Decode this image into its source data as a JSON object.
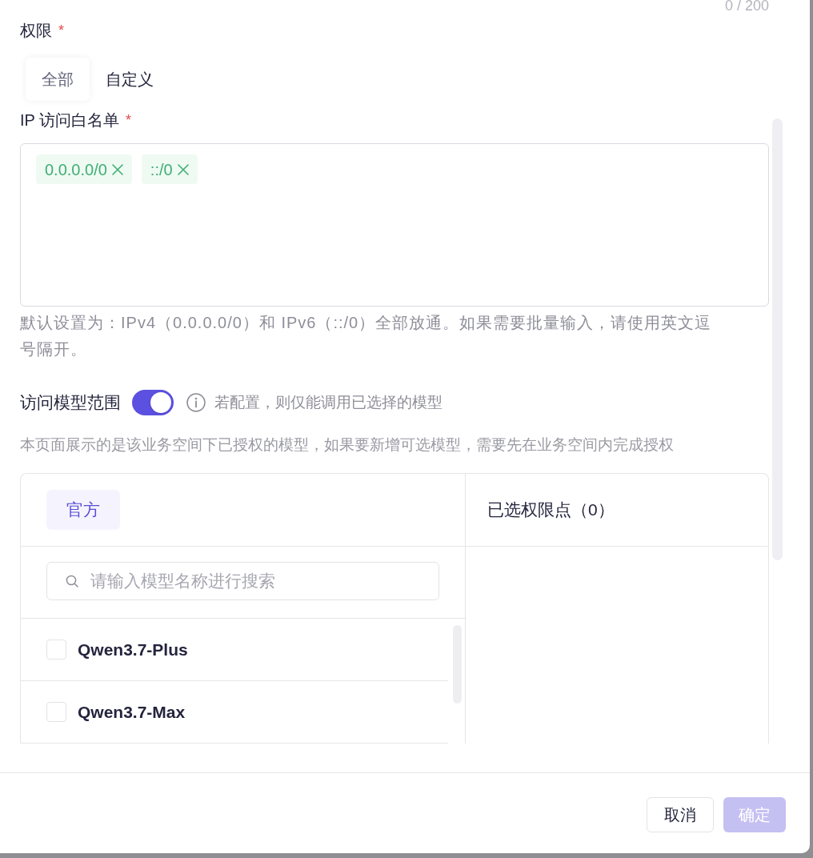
{
  "char_count": "0 / 200",
  "permission": {
    "label": "权限",
    "required_mark": "*",
    "options": [
      {
        "label": "全部",
        "selected": true
      },
      {
        "label": "自定义",
        "selected": false
      }
    ]
  },
  "ip_whitelist": {
    "label": "IP 访问白名单",
    "required_mark": "*",
    "tags": [
      {
        "text": "0.0.0.0/0"
      },
      {
        "text": "::/0"
      }
    ],
    "help": "默认设置为：IPv4（0.0.0.0/0）和 IPv6（::/0）全部放通。如果需要批量输入，请使用英文逗号隔开。"
  },
  "model_scope": {
    "label": "访问模型范围",
    "on": true,
    "hint": "若配置，则仅能调用已选择的模型",
    "description": "本页面展示的是该业务空间下已授权的模型，如果要新增可选模型，需要先在业务空间内完成授权"
  },
  "transfer": {
    "tabs": [
      {
        "label": "官方",
        "selected": true
      }
    ],
    "search": {
      "placeholder": "请输入模型名称进行搜索"
    },
    "models": [
      {
        "name": "Qwen3.7-Plus",
        "checked": false
      },
      {
        "name": "Qwen3.7-Max",
        "checked": false
      }
    ],
    "selected_title": "已选权限点（0）"
  },
  "footer": {
    "buttons": [
      {
        "label": "取消",
        "kind": "secondary",
        "disabled": false
      },
      {
        "label": "确定",
        "kind": "primary",
        "disabled": true
      }
    ]
  }
}
